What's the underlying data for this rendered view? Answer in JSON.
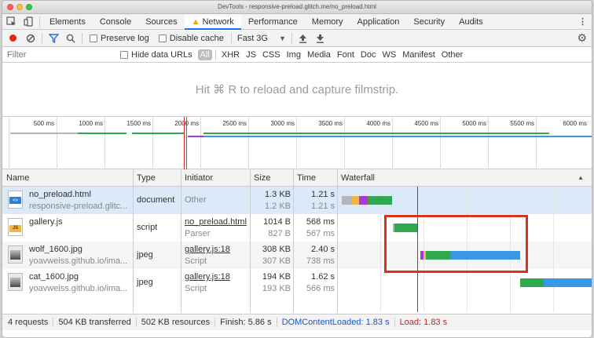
{
  "window": {
    "title": "DevTools - responsive-preload.glitch.me/no_preload.html"
  },
  "tabs": {
    "items": [
      "Elements",
      "Console",
      "Sources",
      "Network",
      "Performance",
      "Memory",
      "Application",
      "Security",
      "Audits"
    ],
    "active": "Network",
    "warning_icon": "warning-triangle-icon"
  },
  "toolbar": {
    "preserve_log": "Preserve log",
    "disable_cache": "Disable cache",
    "throttle_value": "Fast 3G",
    "icons": [
      "record-icon",
      "clear-icon",
      "filter-icon",
      "search-icon",
      "upload-icon",
      "download-icon",
      "gear-icon"
    ]
  },
  "filter": {
    "placeholder": "Filter",
    "hide_data_urls": "Hide data URLs",
    "types": [
      "All",
      "XHR",
      "JS",
      "CSS",
      "Img",
      "Media",
      "Font",
      "Doc",
      "WS",
      "Manifest",
      "Other"
    ],
    "active_type": "All"
  },
  "filmstrip": {
    "message": "Hit ⌘ R to reload and capture filmstrip."
  },
  "overview": {
    "ticks": [
      "500 ms",
      "1000 ms",
      "1500 ms",
      "2000 ms",
      "2500 ms",
      "3000 ms",
      "3500 ms",
      "4000 ms",
      "4500 ms",
      "5000 ms",
      "5500 ms",
      "6000 ms"
    ]
  },
  "columns": {
    "name": "Name",
    "type": "Type",
    "initiator": "Initiator",
    "size": "Size",
    "time": "Time",
    "waterfall": "Waterfall"
  },
  "rows": [
    {
      "name": "no_preload.html",
      "path": "responsive-preload.glitc...",
      "type": "document",
      "initiator": "Other",
      "initiator_sub": "",
      "size": "1.3 KB",
      "size_sub": "1.2 KB",
      "time": "1.21 s",
      "time_sub": "1.21 s",
      "icon": "html-file-icon"
    },
    {
      "name": "gallery.js",
      "path": "",
      "type": "script",
      "initiator": "no_preload.html",
      "initiator_sub": "Parser",
      "size": "1014 B",
      "size_sub": "827 B",
      "time": "568 ms",
      "time_sub": "567 ms",
      "icon": "js-file-icon"
    },
    {
      "name": "wolf_1600.jpg",
      "path": "yoavweiss.github.io/ima...",
      "type": "jpeg",
      "initiator": "gallery.js:18",
      "initiator_sub": "Script",
      "size": "308 KB",
      "size_sub": "307 KB",
      "time": "2.40 s",
      "time_sub": "738 ms",
      "icon": "image-file-icon"
    },
    {
      "name": "cat_1600.jpg",
      "path": "yoavweiss.github.io/ima...",
      "type": "jpeg",
      "initiator": "gallery.js:18",
      "initiator_sub": "Script",
      "size": "194 KB",
      "size_sub": "193 KB",
      "time": "1.62 s",
      "time_sub": "566 ms",
      "icon": "image-file-icon"
    }
  ],
  "status": {
    "requests": "4 requests",
    "transferred": "504 KB transferred",
    "resources": "502 KB resources",
    "finish": "Finish: 5.86 s",
    "dcl": "DOMContentLoaded: 1.83 s",
    "load": "Load: 1.83 s"
  },
  "colors": {
    "waiting": "#2fa84f",
    "download": "#3a97e8",
    "stalled": "#b5b5b5",
    "queue": "#f2b54a",
    "load_line": "#d61f1f",
    "annotation": "#d9351e"
  }
}
